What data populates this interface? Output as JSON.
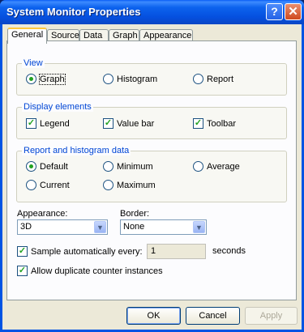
{
  "window": {
    "title": "System Monitor Properties",
    "help_glyph": "?",
    "close_glyph": "✕"
  },
  "tabs": [
    "General",
    "Source",
    "Data",
    "Graph",
    "Appearance"
  ],
  "view": {
    "label": "View",
    "options": [
      "Graph",
      "Histogram",
      "Report"
    ],
    "selected": "Graph"
  },
  "display_elements": {
    "label": "Display elements",
    "items": [
      {
        "label": "Legend",
        "checked": true
      },
      {
        "label": "Value bar",
        "checked": true
      },
      {
        "label": "Toolbar",
        "checked": true
      }
    ]
  },
  "report_data": {
    "label": "Report and histogram data",
    "options": [
      "Default",
      "Minimum",
      "Average",
      "Current",
      "Maximum"
    ],
    "selected": "Default"
  },
  "appearance": {
    "label": "Appearance:",
    "value": "3D"
  },
  "border": {
    "label": "Border:",
    "value": "None"
  },
  "sample": {
    "label": "Sample automatically every:",
    "value": "1",
    "unit": "seconds",
    "checked": true
  },
  "duplicate": {
    "label": "Allow duplicate counter instances",
    "checked": true
  },
  "buttons": {
    "ok": "OK",
    "cancel": "Cancel",
    "apply": "Apply"
  },
  "check_glyph": "✓",
  "dropdown_glyph": "▼"
}
